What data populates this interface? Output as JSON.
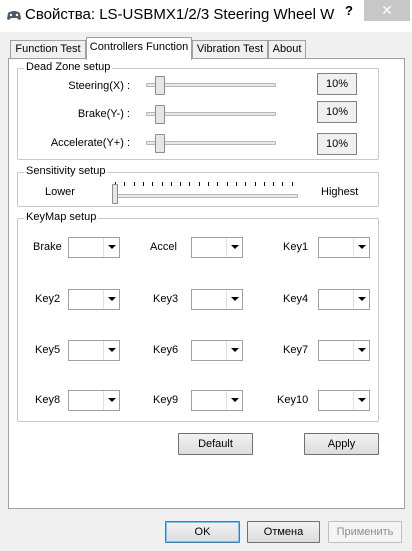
{
  "window": {
    "title": "Свойства: LS-USBMX1/2/3 Steering Wheel W...",
    "help_label": "?",
    "close_label": "✕"
  },
  "tabs": [
    {
      "label": "Function Test",
      "active": false
    },
    {
      "label": "Controllers Function",
      "active": true
    },
    {
      "label": "Vibration Test",
      "active": false
    },
    {
      "label": "About",
      "active": false
    }
  ],
  "dead_zone": {
    "title": "Dead Zone setup",
    "rows": [
      {
        "label": "Steering(X) :",
        "value": "10%",
        "level": 0.1
      },
      {
        "label": "Brake(Y-) :",
        "value": "10%",
        "level": 0.1
      },
      {
        "label": "Accelerate(Y+) :",
        "value": "10%",
        "level": 0.1
      }
    ]
  },
  "sensitivity": {
    "title": "Sensitivity setup",
    "low_label": "Lower",
    "high_label": "Highest",
    "level": 0.0
  },
  "keymap": {
    "title": "KeyMap setup",
    "items": [
      {
        "label": "Brake",
        "value": ""
      },
      {
        "label": "Accel",
        "value": ""
      },
      {
        "label": "Key1",
        "value": ""
      },
      {
        "label": "Key2",
        "value": ""
      },
      {
        "label": "Key3",
        "value": ""
      },
      {
        "label": "Key4",
        "value": ""
      },
      {
        "label": "Key5",
        "value": ""
      },
      {
        "label": "Key6",
        "value": ""
      },
      {
        "label": "Key7",
        "value": ""
      },
      {
        "label": "Key8",
        "value": ""
      },
      {
        "label": "Key9",
        "value": ""
      },
      {
        "label": "Key10",
        "value": ""
      }
    ]
  },
  "panel_buttons": {
    "default_label": "Default",
    "apply_label": "Apply"
  },
  "dialog_buttons": {
    "ok_label": "OK",
    "cancel_label": "Отмена",
    "apply_label": "Применить"
  }
}
